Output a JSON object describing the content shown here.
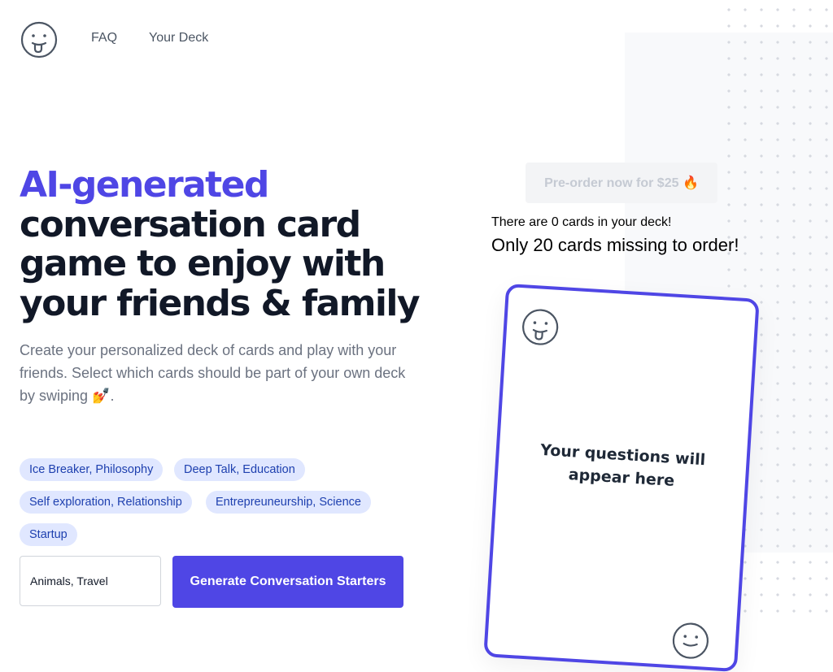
{
  "nav": {
    "faq": "FAQ",
    "deck": "Your Deck"
  },
  "hero": {
    "accent": "AI-generated",
    "title_rest": "conversation card game to enjoy with your friends & family",
    "subtitle": "Create your personalized deck of cards and play with your friends. Select which cards should be part of your own deck by swiping 💅."
  },
  "tags": [
    "Ice Breaker, Philosophy",
    "Deep Talk, Education",
    "Self exploration, Relationship",
    "Entrepreuneurship, Science",
    "Startup"
  ],
  "topic_input": {
    "value": "Animals, Travel"
  },
  "generate_label": "Generate Conversation Starters",
  "preorder_label": "Pre-order now for $25 🔥",
  "deck": {
    "count_text": "There are 0 cards in your deck!",
    "missing_text": "Only 20 cards missing to order!"
  },
  "card": {
    "placeholder": "Your questions will appear here"
  },
  "icons": {
    "logo": "tongue-out-face-icon"
  },
  "colors": {
    "accent": "#4f46e5",
    "tag_bg": "#e0e7ff",
    "tag_text": "#1e40af"
  }
}
